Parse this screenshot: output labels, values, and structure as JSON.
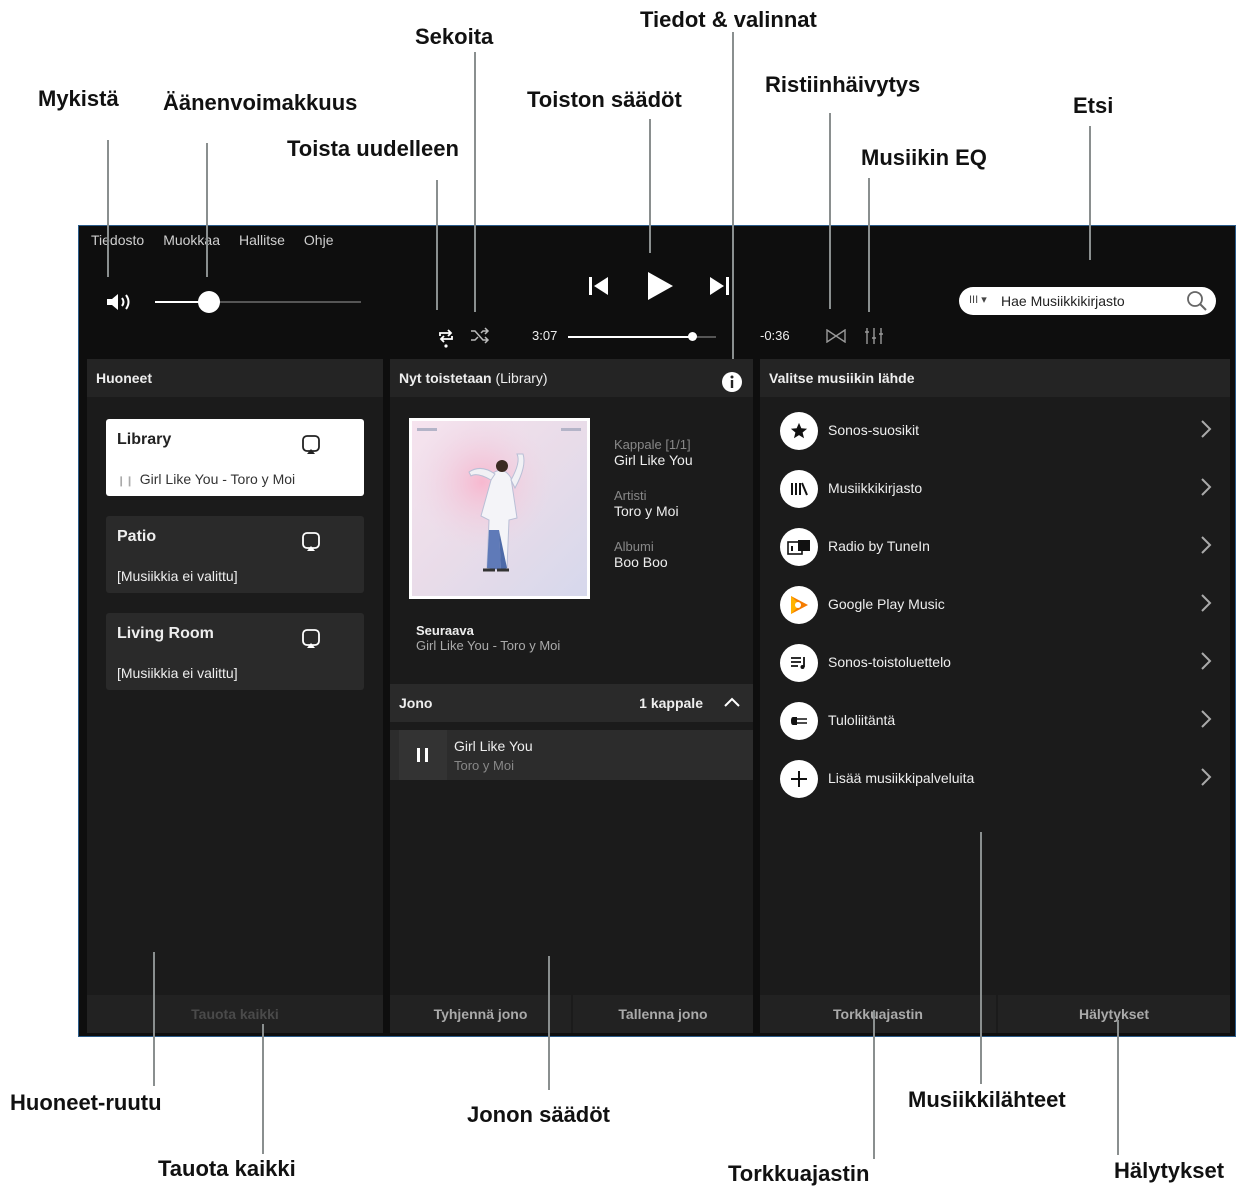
{
  "callouts": {
    "mute": "Mykistä",
    "volume": "Äänenvoimakkuus",
    "shuffle": "Sekoita",
    "info": "Tiedot & valinnat",
    "repeat": "Toista uudelleen",
    "playback": "Toiston säädöt",
    "crossfade": "Ristiinhäivytys",
    "search": "Etsi",
    "eq": "Musiikin EQ",
    "rooms_pane": "Huoneet-ruutu",
    "pause_all": "Tauota kaikki",
    "queue_controls": "Jonon säädöt",
    "music_sources": "Musiikkilähteet",
    "sleep_timer": "Torkkuajastin",
    "alarms": "Hälytykset"
  },
  "menu": [
    "Tiedosto",
    "Muokkaa",
    "Hallitse",
    "Ohje"
  ],
  "volume_level": 0.26,
  "playback": {
    "elapsed": "3:07",
    "remaining": "-0:36",
    "progress": 0.84
  },
  "search": {
    "source": "III",
    "placeholder": "Hae Musiikkikirjasto"
  },
  "rooms": {
    "title": "Huoneet",
    "items": [
      {
        "name": "Library",
        "status": "Girl Like You - Toro y Moi",
        "active": true
      },
      {
        "name": "Patio",
        "status": "[Musiikkia ei valittu]",
        "active": false
      },
      {
        "name": "Living Room",
        "status": "[Musiikkia ei valittu]",
        "active": false
      }
    ],
    "pause_all": "Tauota kaikki"
  },
  "now_playing": {
    "title": "Nyt toistetaan",
    "title_suffix": "(Library)",
    "track_label": "Kappale [1/1]",
    "track": "Girl Like You",
    "artist_label": "Artisti",
    "artist": "Toro y Moi",
    "album_label": "Albumi",
    "album": "Boo Boo",
    "next_label": "Seuraava",
    "next": "Girl Like You - Toro y Moi"
  },
  "queue": {
    "title": "Jono",
    "count": "1 kappale",
    "items": [
      {
        "title": "Girl Like You",
        "artist": "Toro y Moi"
      }
    ],
    "clear": "Tyhjennä jono",
    "save": "Tallenna jono"
  },
  "sources": {
    "title": "Valitse musiikin lähde",
    "items": [
      {
        "label": "Sonos-suosikit",
        "icon": "star-icon"
      },
      {
        "label": "Musiikkikirjasto",
        "icon": "library-icon"
      },
      {
        "label": "Radio by TuneIn",
        "icon": "tunein-icon"
      },
      {
        "label": "Google Play Music",
        "icon": "google-play-icon"
      },
      {
        "label": "Sonos-toistoluettelo",
        "icon": "playlist-icon"
      },
      {
        "label": "Tuloliitäntä",
        "icon": "line-in-icon"
      },
      {
        "label": "Lisää musiikkipalveluita",
        "icon": "plus-icon"
      }
    ],
    "sleep_timer": "Torkkuajastin",
    "alarms": "Hälytykset"
  }
}
